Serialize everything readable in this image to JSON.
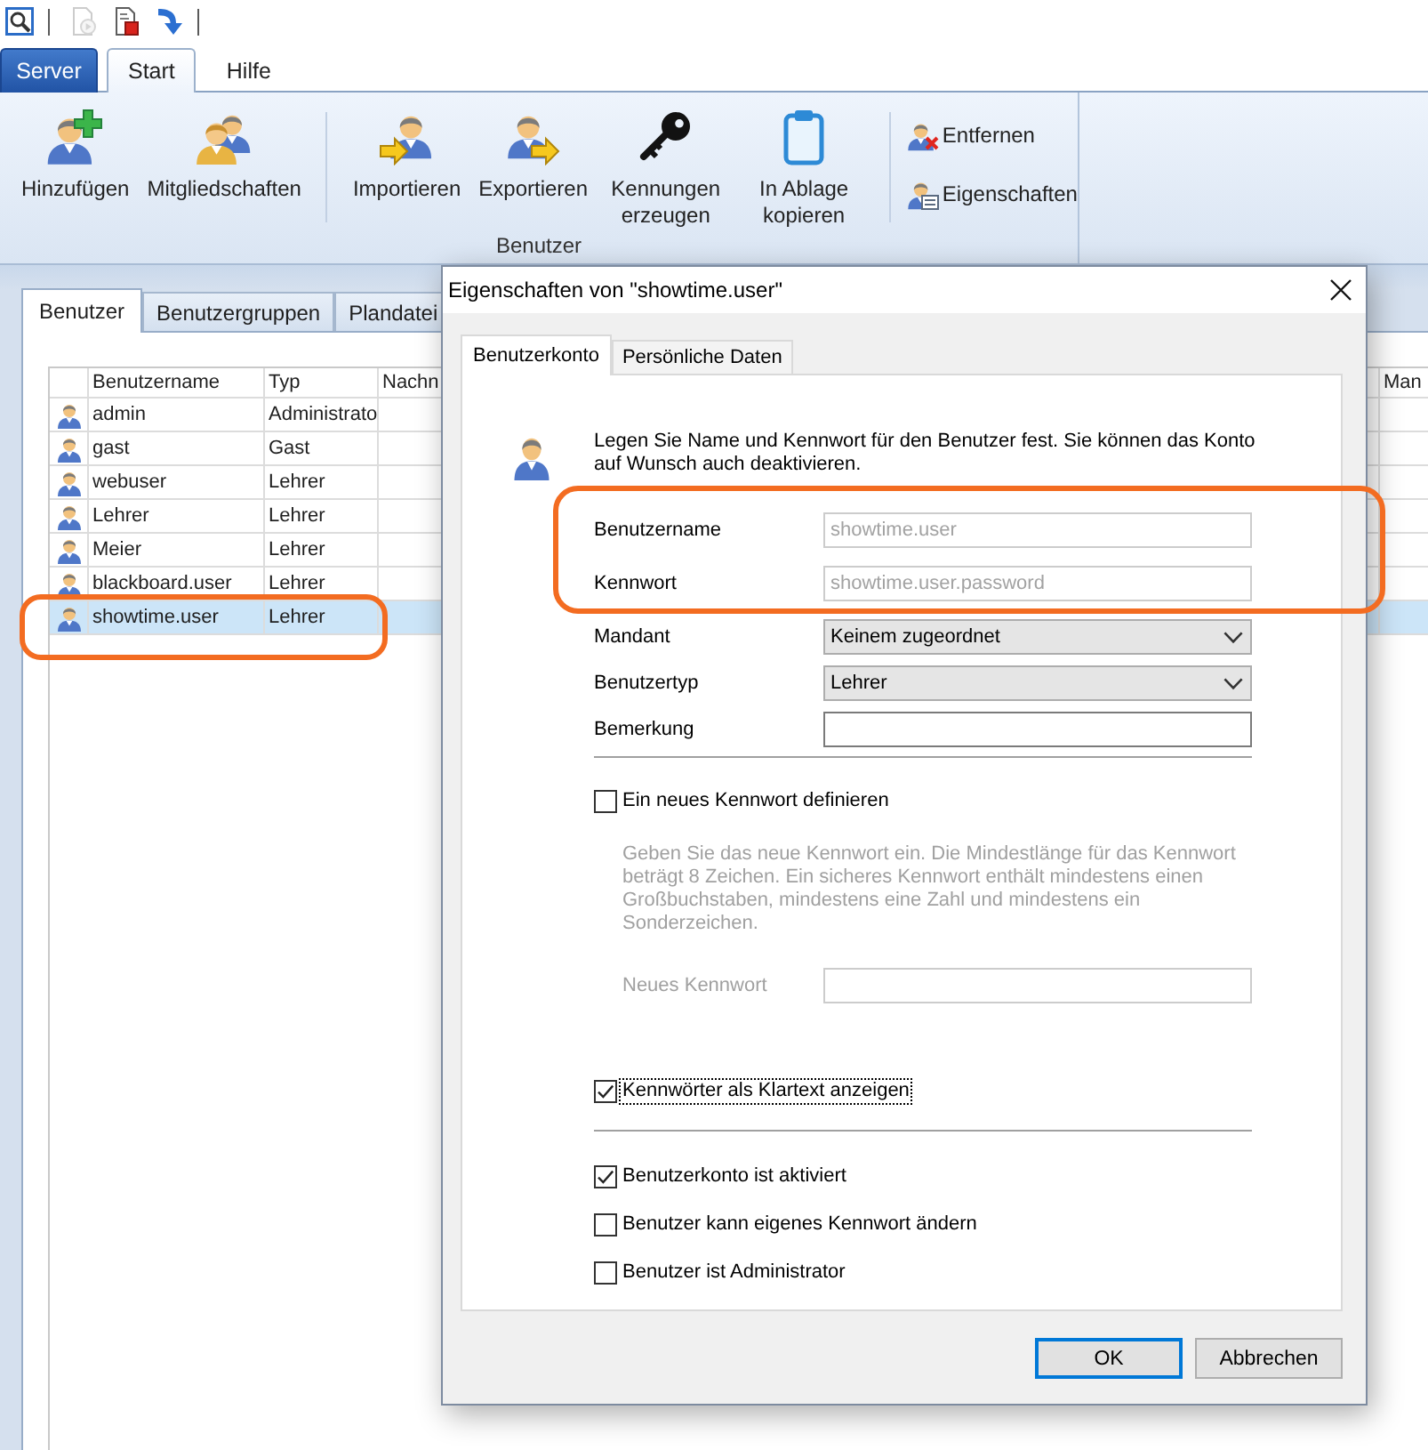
{
  "quick_access": {
    "groups": [
      {
        "buttons": [
          {
            "kind": "preview",
            "disabled": false
          }
        ]
      },
      {
        "buttons": [
          {
            "kind": "document-play",
            "disabled": true
          },
          {
            "kind": "document-stop",
            "disabled": false
          },
          {
            "kind": "arrow-down",
            "disabled": false
          }
        ]
      }
    ]
  },
  "ribbon": {
    "tabs": [
      {
        "label": "Server",
        "kind": "application",
        "selected": false
      },
      {
        "label": "Start",
        "kind": "tab",
        "selected": true
      },
      {
        "label": "Hilfe",
        "kind": "tab",
        "selected": false
      }
    ],
    "groups": [
      {
        "label": "Benutzer",
        "sections": [
          {
            "kind": "large",
            "buttons": [
              {
                "label": "Hinzufügen",
                "kind": "add-user"
              },
              {
                "label": "Mitgliedschaften",
                "kind": "memberships"
              }
            ]
          },
          {
            "kind": "large",
            "buttons": [
              {
                "label": "Importieren",
                "kind": "import"
              },
              {
                "label": "Exportieren",
                "kind": "export"
              },
              {
                "label": "Kennungen erzeugen",
                "kind": "key"
              },
              {
                "label": "In Ablage kopieren",
                "kind": "clipboard"
              }
            ]
          },
          {
            "kind": "small",
            "buttons": [
              {
                "label": "Entfernen",
                "kind": "remove-user"
              },
              {
                "label": "Eigenschaften",
                "kind": "user-properties"
              }
            ]
          }
        ]
      }
    ]
  },
  "content": {
    "tabs": [
      {
        "label": "Benutzer",
        "selected": true
      },
      {
        "label": "Benutzergruppen",
        "selected": false
      },
      {
        "label": "Plandatei",
        "selected": false
      }
    ],
    "table": {
      "columns": [
        "Benutzername",
        "Typ",
        "Nachn",
        "Man"
      ],
      "rows": [
        {
          "cells": [
            "admin",
            "Administrato"
          ],
          "selected": false,
          "highlighted": false
        },
        {
          "cells": [
            "gast",
            "Gast"
          ],
          "selected": false,
          "highlighted": false
        },
        {
          "cells": [
            "webuser",
            "Lehrer"
          ],
          "selected": false,
          "highlighted": false
        },
        {
          "cells": [
            "Lehrer",
            "Lehrer"
          ],
          "selected": false,
          "highlighted": false
        },
        {
          "cells": [
            "Meier",
            "Lehrer"
          ],
          "selected": false,
          "highlighted": false
        },
        {
          "cells": [
            "blackboard.user",
            "Lehrer"
          ],
          "selected": false,
          "highlighted": false
        },
        {
          "cells": [
            "showtime.user",
            "Lehrer"
          ],
          "selected": true,
          "highlighted": true
        }
      ]
    }
  },
  "dialog": {
    "title": "Eigenschaften von \"showtime.user\"",
    "tabs": [
      {
        "label": "Benutzerkonto",
        "selected": true
      },
      {
        "label": "Persönliche Daten",
        "selected": false
      }
    ],
    "intro": "Legen Sie Name und Kennwort für den Benutzer fest. Sie können das Konto auf Wunsch auch deaktivieren.",
    "fields": [
      {
        "label": "Benutzername",
        "kind": "text",
        "value": "showtime.user",
        "disabled": true,
        "highlighted": true
      },
      {
        "label": "Kennwort",
        "kind": "text",
        "value": "showtime.user.password",
        "disabled": true,
        "highlighted": true
      },
      {
        "label": "Mandant",
        "kind": "select",
        "value": "Keinem zugeordnet",
        "disabled": false,
        "highlighted": false
      },
      {
        "label": "Benutzertyp",
        "kind": "select",
        "value": "Lehrer",
        "disabled": false,
        "highlighted": false
      },
      {
        "label": "Bemerkung",
        "kind": "text",
        "disabled": false,
        "highlighted": false
      }
    ],
    "new_password": {
      "label": "Ein neues Kennwort definieren",
      "checked": false,
      "hint": "Geben Sie das neue Kennwort ein. Die Mindestlänge für das Kennwort beträgt 8 Zeichen. Ein sicheres Kennwort enthält mindestens einen Großbuchstaben, mindestens eine Zahl und mindestens ein Sonderzeichen.",
      "field_label": "Neues Kennwort"
    },
    "show_plaintext": {
      "label": "Kennwörter als Klartext anzeigen",
      "checked": true,
      "focused": true
    },
    "options": [
      {
        "label": "Benutzerkonto ist aktiviert",
        "checked": true
      },
      {
        "label": "Benutzer kann eigenes Kennwort ändern",
        "checked": false
      },
      {
        "label": "Benutzer ist Administrator",
        "checked": false
      }
    ],
    "buttons": [
      {
        "label": "OK",
        "default": true
      },
      {
        "label": "Abbrechen",
        "default": false
      }
    ]
  }
}
